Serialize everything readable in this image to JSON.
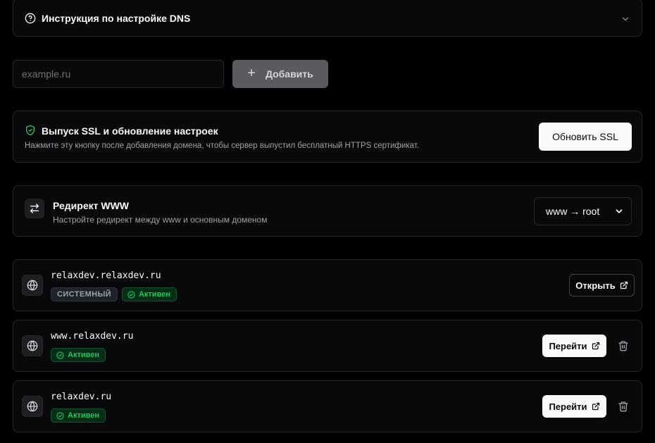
{
  "dns_section": {
    "title": "Инструкция по настройке DNS"
  },
  "add_domain": {
    "placeholder": "example.ru",
    "button_label": "Добавить"
  },
  "ssl": {
    "title": "Выпуск SSL и обновление настроек",
    "description": "Нажмите эту кнопку после добавления домена, чтобы сервер выпустил бесплатный HTTPS сертификат.",
    "button_label": "Обновить SSL"
  },
  "redirect": {
    "title": "Редирект WWW",
    "description": "Настройте редирект между www и основным доменом",
    "selected": "www → root"
  },
  "domains": [
    {
      "name": "relaxdev.relaxdev.ru",
      "system_badge": "СИСТЕМНЫЙ",
      "status": "Активен",
      "action_label": "Открыть"
    },
    {
      "name": "www.relaxdev.ru",
      "status": "Активен",
      "action_label": "Перейти"
    },
    {
      "name": "relaxdev.ru",
      "status": "Активен",
      "action_label": "Перейти"
    }
  ],
  "colors": {
    "accent_green": "#22c55e",
    "background": "#000000",
    "card": "#09090b",
    "border": "#27272a"
  },
  "icons": [
    "help-circle-icon",
    "chevron-down-icon",
    "plus-icon",
    "shield-check-icon",
    "arrows-swap-icon",
    "chevron-down-icon",
    "globe-icon",
    "check-circle-icon",
    "external-link-icon",
    "trash-icon"
  ]
}
